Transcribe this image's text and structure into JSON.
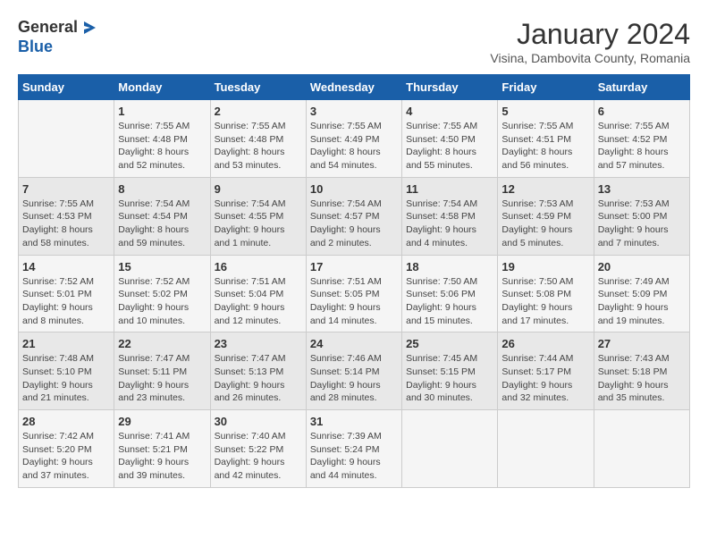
{
  "header": {
    "logo_text_general": "General",
    "logo_text_blue": "Blue",
    "month_title": "January 2024",
    "subtitle": "Visina, Dambovita County, Romania"
  },
  "days_of_week": [
    "Sunday",
    "Monday",
    "Tuesday",
    "Wednesday",
    "Thursday",
    "Friday",
    "Saturday"
  ],
  "weeks": [
    [
      {
        "day": "",
        "info": ""
      },
      {
        "day": "1",
        "info": "Sunrise: 7:55 AM\nSunset: 4:48 PM\nDaylight: 8 hours\nand 52 minutes."
      },
      {
        "day": "2",
        "info": "Sunrise: 7:55 AM\nSunset: 4:48 PM\nDaylight: 8 hours\nand 53 minutes."
      },
      {
        "day": "3",
        "info": "Sunrise: 7:55 AM\nSunset: 4:49 PM\nDaylight: 8 hours\nand 54 minutes."
      },
      {
        "day": "4",
        "info": "Sunrise: 7:55 AM\nSunset: 4:50 PM\nDaylight: 8 hours\nand 55 minutes."
      },
      {
        "day": "5",
        "info": "Sunrise: 7:55 AM\nSunset: 4:51 PM\nDaylight: 8 hours\nand 56 minutes."
      },
      {
        "day": "6",
        "info": "Sunrise: 7:55 AM\nSunset: 4:52 PM\nDaylight: 8 hours\nand 57 minutes."
      }
    ],
    [
      {
        "day": "7",
        "info": "Sunrise: 7:55 AM\nSunset: 4:53 PM\nDaylight: 8 hours\nand 58 minutes."
      },
      {
        "day": "8",
        "info": "Sunrise: 7:54 AM\nSunset: 4:54 PM\nDaylight: 8 hours\nand 59 minutes."
      },
      {
        "day": "9",
        "info": "Sunrise: 7:54 AM\nSunset: 4:55 PM\nDaylight: 9 hours\nand 1 minute."
      },
      {
        "day": "10",
        "info": "Sunrise: 7:54 AM\nSunset: 4:57 PM\nDaylight: 9 hours\nand 2 minutes."
      },
      {
        "day": "11",
        "info": "Sunrise: 7:54 AM\nSunset: 4:58 PM\nDaylight: 9 hours\nand 4 minutes."
      },
      {
        "day": "12",
        "info": "Sunrise: 7:53 AM\nSunset: 4:59 PM\nDaylight: 9 hours\nand 5 minutes."
      },
      {
        "day": "13",
        "info": "Sunrise: 7:53 AM\nSunset: 5:00 PM\nDaylight: 9 hours\nand 7 minutes."
      }
    ],
    [
      {
        "day": "14",
        "info": "Sunrise: 7:52 AM\nSunset: 5:01 PM\nDaylight: 9 hours\nand 8 minutes."
      },
      {
        "day": "15",
        "info": "Sunrise: 7:52 AM\nSunset: 5:02 PM\nDaylight: 9 hours\nand 10 minutes."
      },
      {
        "day": "16",
        "info": "Sunrise: 7:51 AM\nSunset: 5:04 PM\nDaylight: 9 hours\nand 12 minutes."
      },
      {
        "day": "17",
        "info": "Sunrise: 7:51 AM\nSunset: 5:05 PM\nDaylight: 9 hours\nand 14 minutes."
      },
      {
        "day": "18",
        "info": "Sunrise: 7:50 AM\nSunset: 5:06 PM\nDaylight: 9 hours\nand 15 minutes."
      },
      {
        "day": "19",
        "info": "Sunrise: 7:50 AM\nSunset: 5:08 PM\nDaylight: 9 hours\nand 17 minutes."
      },
      {
        "day": "20",
        "info": "Sunrise: 7:49 AM\nSunset: 5:09 PM\nDaylight: 9 hours\nand 19 minutes."
      }
    ],
    [
      {
        "day": "21",
        "info": "Sunrise: 7:48 AM\nSunset: 5:10 PM\nDaylight: 9 hours\nand 21 minutes."
      },
      {
        "day": "22",
        "info": "Sunrise: 7:47 AM\nSunset: 5:11 PM\nDaylight: 9 hours\nand 23 minutes."
      },
      {
        "day": "23",
        "info": "Sunrise: 7:47 AM\nSunset: 5:13 PM\nDaylight: 9 hours\nand 26 minutes."
      },
      {
        "day": "24",
        "info": "Sunrise: 7:46 AM\nSunset: 5:14 PM\nDaylight: 9 hours\nand 28 minutes."
      },
      {
        "day": "25",
        "info": "Sunrise: 7:45 AM\nSunset: 5:15 PM\nDaylight: 9 hours\nand 30 minutes."
      },
      {
        "day": "26",
        "info": "Sunrise: 7:44 AM\nSunset: 5:17 PM\nDaylight: 9 hours\nand 32 minutes."
      },
      {
        "day": "27",
        "info": "Sunrise: 7:43 AM\nSunset: 5:18 PM\nDaylight: 9 hours\nand 35 minutes."
      }
    ],
    [
      {
        "day": "28",
        "info": "Sunrise: 7:42 AM\nSunset: 5:20 PM\nDaylight: 9 hours\nand 37 minutes."
      },
      {
        "day": "29",
        "info": "Sunrise: 7:41 AM\nSunset: 5:21 PM\nDaylight: 9 hours\nand 39 minutes."
      },
      {
        "day": "30",
        "info": "Sunrise: 7:40 AM\nSunset: 5:22 PM\nDaylight: 9 hours\nand 42 minutes."
      },
      {
        "day": "31",
        "info": "Sunrise: 7:39 AM\nSunset: 5:24 PM\nDaylight: 9 hours\nand 44 minutes."
      },
      {
        "day": "",
        "info": ""
      },
      {
        "day": "",
        "info": ""
      },
      {
        "day": "",
        "info": ""
      }
    ]
  ]
}
